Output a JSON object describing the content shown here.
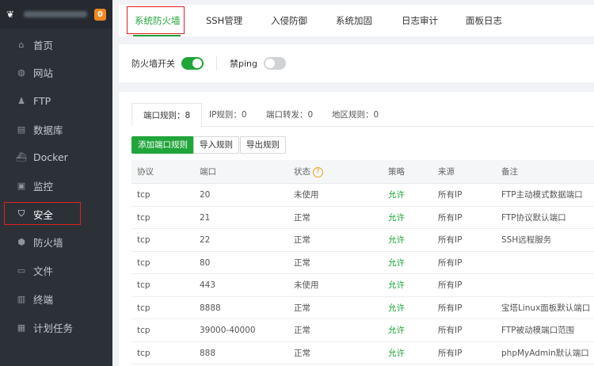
{
  "sidebar": {
    "badge": "0",
    "items": [
      {
        "label": "首页",
        "icon": "home-icon",
        "glyph": "⌂"
      },
      {
        "label": "网站",
        "icon": "globe-icon",
        "glyph": "◍"
      },
      {
        "label": "FTP",
        "icon": "user-icon",
        "glyph": "♟"
      },
      {
        "label": "数据库",
        "icon": "database-icon",
        "glyph": "▤"
      },
      {
        "label": "Docker",
        "icon": "docker-icon",
        "glyph": "⛴"
      },
      {
        "label": "监控",
        "icon": "monitor-icon",
        "glyph": "▣"
      },
      {
        "label": "安全",
        "icon": "shield-check-icon",
        "glyph": "⛉"
      },
      {
        "label": "防火墙",
        "icon": "shield-icon",
        "glyph": "⬢"
      },
      {
        "label": "文件",
        "icon": "folder-icon",
        "glyph": "▭"
      },
      {
        "label": "终端",
        "icon": "terminal-icon",
        "glyph": "▥"
      },
      {
        "label": "计划任务",
        "icon": "calendar-icon",
        "glyph": "▦"
      }
    ]
  },
  "tabs": [
    "系统防火墙",
    "SSH管理",
    "入侵防御",
    "系统加固",
    "日志审计",
    "面板日志"
  ],
  "switches": {
    "firewall_label": "防火墙开关",
    "ping_label": "禁ping"
  },
  "subtabs": [
    "端口规则：8",
    "IP规则：0",
    "端口转发：0",
    "地区规则：0"
  ],
  "buttons": {
    "add": "添加端口规则",
    "import": "导入规则",
    "export": "导出规则"
  },
  "table": {
    "headers": [
      "协议",
      "端口",
      "状态",
      "策略",
      "来源",
      "备注"
    ],
    "rows": [
      [
        "tcp",
        "20",
        "未使用",
        "允许",
        "所有IP",
        "FTP主动模式数据端口"
      ],
      [
        "tcp",
        "21",
        "正常",
        "允许",
        "所有IP",
        "FTP协议默认端口"
      ],
      [
        "tcp",
        "22",
        "正常",
        "允许",
        "所有IP",
        "SSH远程服务"
      ],
      [
        "tcp",
        "80",
        "正常",
        "允许",
        "所有IP",
        ""
      ],
      [
        "tcp",
        "443",
        "未使用",
        "允许",
        "所有IP",
        ""
      ],
      [
        "tcp",
        "8888",
        "正常",
        "允许",
        "所有IP",
        "宝塔Linux面板默认端口"
      ],
      [
        "tcp",
        "39000-40000",
        "正常",
        "允许",
        "所有IP",
        "FTP被动模端口范围"
      ],
      [
        "tcp",
        "888",
        "正常",
        "允许",
        "所有IP",
        "phpMyAdmin默认端口"
      ]
    ]
  },
  "colors": {
    "accent": "#20a53a",
    "highlight": "#e02020",
    "sidebar": "#2c3138"
  }
}
